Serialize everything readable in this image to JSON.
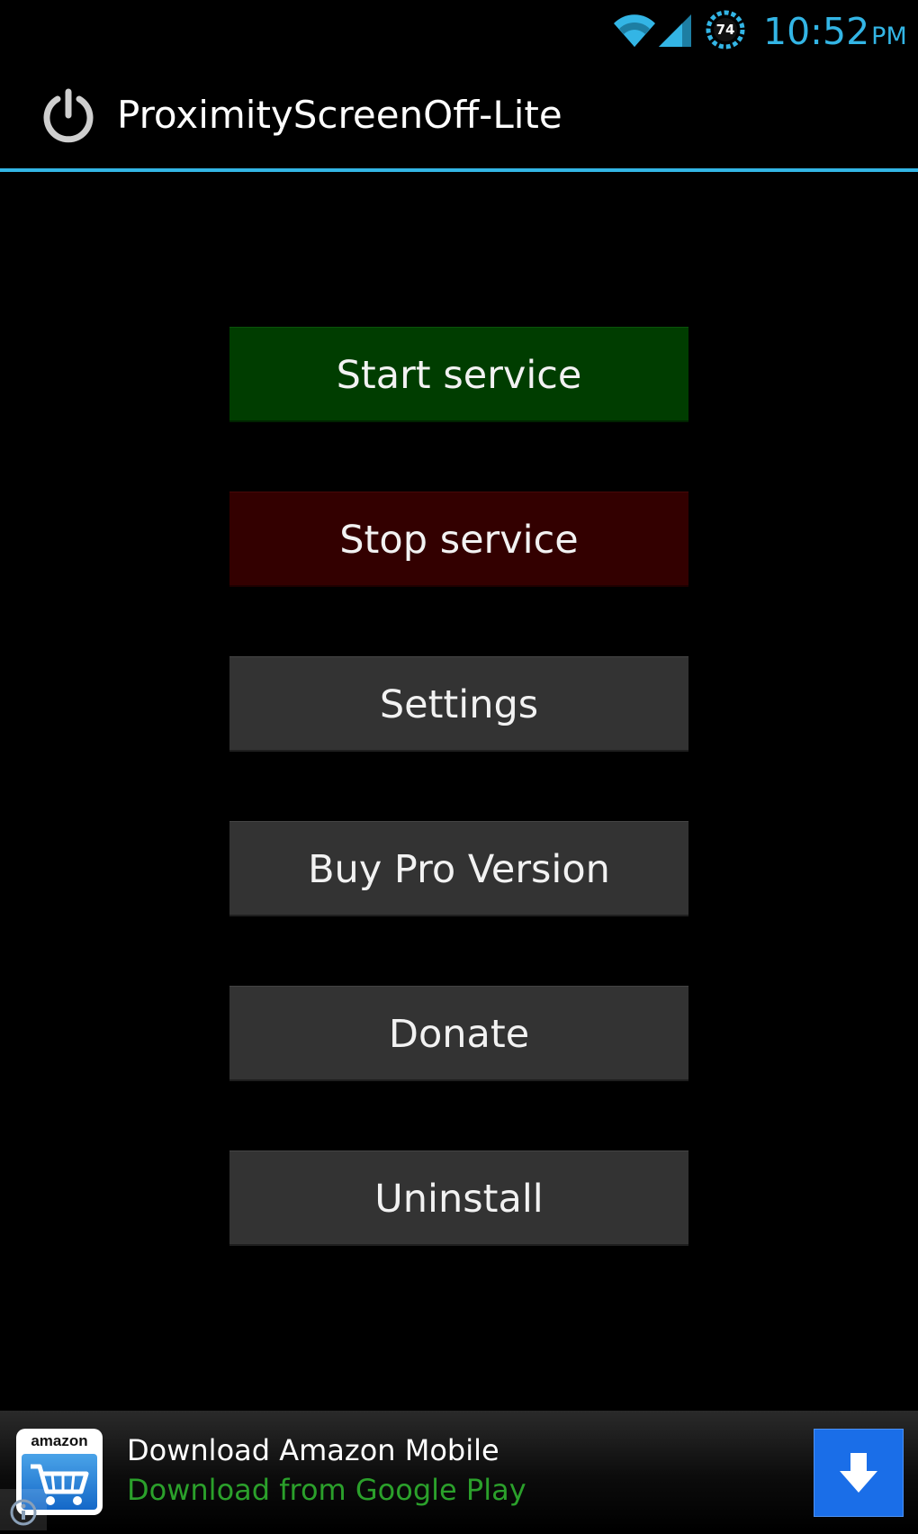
{
  "status_bar": {
    "time": "10:52",
    "ampm": "PM",
    "battery_level": "74",
    "accent_color": "#33b5e5",
    "icons": [
      "wifi-icon",
      "signal-icon",
      "battery-icon"
    ]
  },
  "action_bar": {
    "title": "ProximityScreenOff-Lite",
    "icon": "power-icon",
    "divider_color": "#33b5e5"
  },
  "buttons": {
    "start": "Start service",
    "stop": "Stop service",
    "settings": "Settings",
    "buy_pro": "Buy Pro Version",
    "donate": "Donate",
    "uninstall": "Uninstall",
    "colors": {
      "start": "#003d00",
      "stop": "#330000",
      "default": "#333333"
    }
  },
  "ad": {
    "logo_text": "amazon",
    "title": "Download Amazon Mobile",
    "subtitle": "Download from Google Play",
    "subtitle_color": "#2ba02b",
    "download_icon": "download-arrow-icon",
    "info_icon": "info-icon"
  }
}
